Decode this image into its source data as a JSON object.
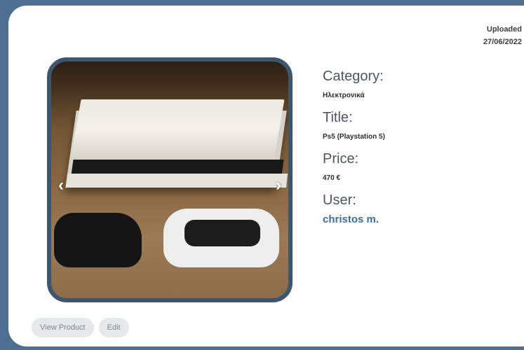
{
  "product": {
    "uploaded_label": "Uploaded",
    "uploaded_date": "27/06/2022",
    "category_label": "Category:",
    "category_value": "Ηλεκτρονικά",
    "title_label": "Title:",
    "title_value": "Ps5 (Playstation 5)",
    "price_label": "Price:",
    "price_value": "470 €",
    "user_label": "User:",
    "user_value": "christos m."
  },
  "gallery": {
    "prev_arrow": "‹",
    "next_arrow": "›"
  },
  "actions": {
    "view_label": "View Product",
    "edit_label": "Edit"
  }
}
